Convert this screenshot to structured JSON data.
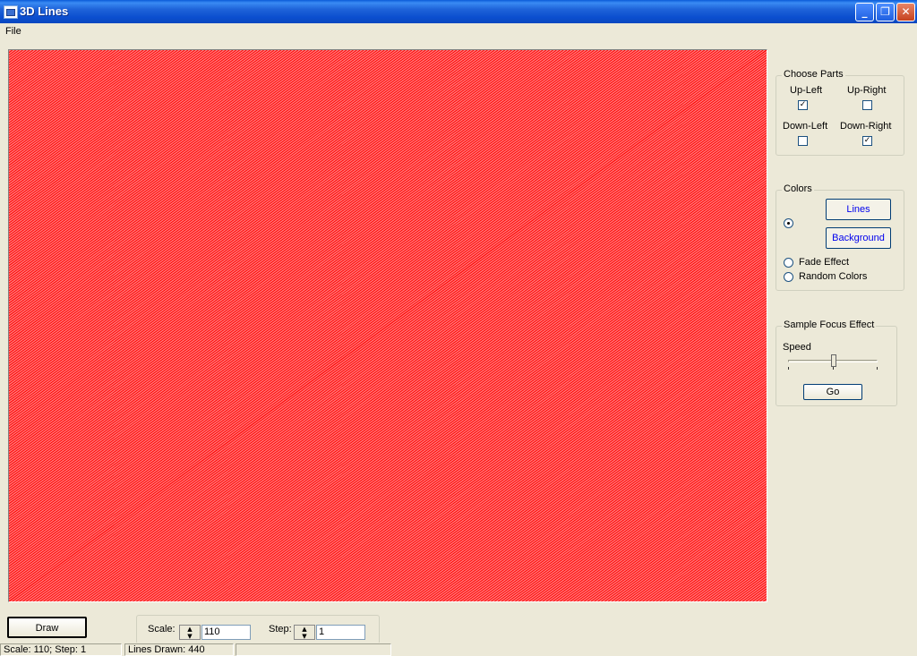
{
  "window": {
    "title": "3D Lines"
  },
  "menu": {
    "file": "File"
  },
  "canvas": {
    "line_color": "#FF0000",
    "background_color": "#FF8080"
  },
  "choose_parts": {
    "title": "Choose Parts",
    "up_left": {
      "label": "Up-Left",
      "checked": true
    },
    "up_right": {
      "label": "Up-Right",
      "checked": false
    },
    "down_left": {
      "label": "Down-Left",
      "checked": false
    },
    "down_right": {
      "label": "Down-Right",
      "checked": true
    }
  },
  "colors": {
    "title": "Colors",
    "lines_button": "Lines",
    "background_button": "Background",
    "fade_effect": "Fade Effect",
    "random_colors": "Random Colors"
  },
  "focus": {
    "title": "Sample Focus Effect",
    "speed_label": "Speed",
    "go_button": "Go"
  },
  "controls": {
    "draw_button": "Draw",
    "scale_label": "Scale:",
    "scale_value": "110",
    "step_label": "Step:",
    "step_value": "1"
  },
  "status": {
    "panel1": "Scale: 110; Step: 1",
    "panel2": "Lines Drawn: 440",
    "panel3": ""
  },
  "icons": {
    "app": "app-window-icon",
    "minimize": "minimize-icon",
    "restore": "restore-icon",
    "close": "close-icon"
  }
}
